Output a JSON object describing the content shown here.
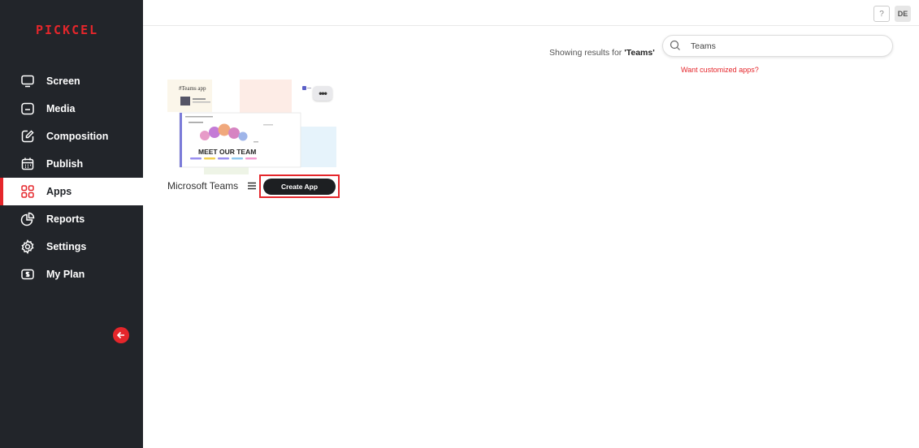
{
  "brand": {
    "logo_text": "PICKCEL",
    "accent_color": "#e5262b",
    "sidebar_bg": "#22252a"
  },
  "sidebar": {
    "items": [
      {
        "label": "Screen",
        "icon": "monitor-icon",
        "active": false
      },
      {
        "label": "Media",
        "icon": "folder-icon",
        "active": false
      },
      {
        "label": "Composition",
        "icon": "edit-icon",
        "active": false
      },
      {
        "label": "Publish",
        "icon": "calendar-icon",
        "active": false
      },
      {
        "label": "Apps",
        "icon": "apps-grid-icon",
        "active": true
      },
      {
        "label": "Reports",
        "icon": "pie-chart-icon",
        "active": false
      },
      {
        "label": "Settings",
        "icon": "gear-icon",
        "active": false
      },
      {
        "label": "My Plan",
        "icon": "plan-icon",
        "active": false
      }
    ],
    "collapse_icon": "arrow-left-icon"
  },
  "topbar": {
    "help_label": "?",
    "avatar_initials": "DE"
  },
  "search": {
    "results_prefix": "Showing results for ",
    "results_query": "'Teams'",
    "value": "Teams",
    "icon": "search-icon",
    "custom_link": "Want customized apps?"
  },
  "apps": [
    {
      "name": "Microsoft Teams",
      "thumbnail_heading": "#Teams app",
      "thumbnail_banner": "MEET OUR TEAM",
      "more_label": "•••",
      "create_label": "Create App"
    }
  ]
}
